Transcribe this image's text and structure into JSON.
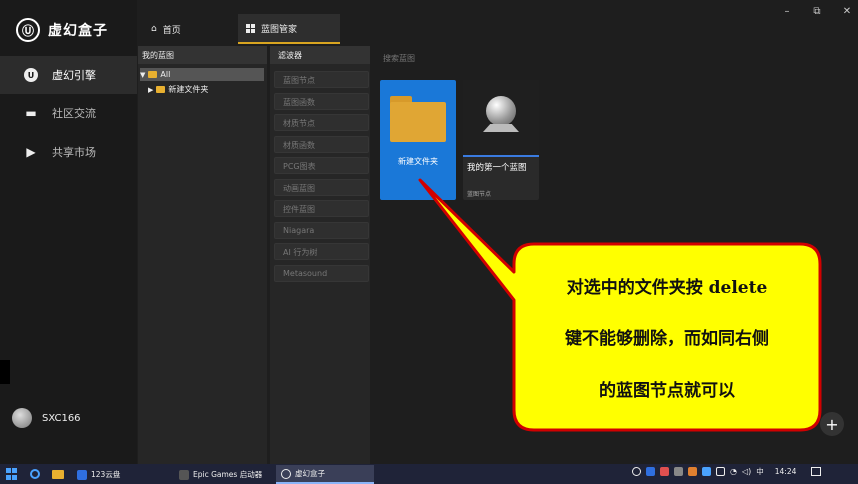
{
  "app": {
    "brand": "虚幻盒子",
    "nav": [
      {
        "label": "虚幻引擎",
        "icon": "unreal-icon",
        "glyph": "U"
      },
      {
        "label": "社区交流",
        "icon": "chat-icon",
        "glyph": "▬"
      },
      {
        "label": "共享市场",
        "icon": "play-icon",
        "glyph": "▶"
      }
    ],
    "user": {
      "name": "SXC166"
    }
  },
  "tabs": [
    {
      "label": "首页",
      "glyph": "⌂"
    },
    {
      "label": "蓝图管家"
    }
  ],
  "window_controls": {
    "minimize": "–",
    "restore": "⧉",
    "close": "✕"
  },
  "tree_panel": {
    "title": "我的蓝图",
    "items": [
      {
        "label": "All",
        "expand": "▼"
      },
      {
        "label": "新建文件夹",
        "expand": "▶"
      }
    ]
  },
  "filter_panel": {
    "title": "滤波器",
    "filters": [
      "蓝图节点",
      "蓝图函数",
      "材质节点",
      "材质函数",
      "PCG图表",
      "动画蓝图",
      "控件蓝图",
      "Niagara",
      "AI 行为树",
      "Metasound"
    ]
  },
  "content": {
    "search_placeholder": "搜索蓝图",
    "folder_card": {
      "label": "新建文件夹"
    },
    "bp_card": {
      "label": "我的第一个蓝图",
      "type": "蓝图节点"
    },
    "add_glyph": "+"
  },
  "annotation": {
    "lines": [
      "对选中的文件夹按 delete",
      "键不能够删除，而如同右侧",
      "的蓝图节点就可以"
    ]
  },
  "taskbar": {
    "tasks": [
      "123云盘",
      "Epic Games 启动器",
      "虚幻盒子"
    ],
    "tray_input": "中",
    "time": "14:24"
  },
  "colors": {
    "accent_tab": "#d9a520",
    "folder_card": "#1a78d8",
    "callout_fill": "#ffff00",
    "callout_border": "#d10000"
  }
}
